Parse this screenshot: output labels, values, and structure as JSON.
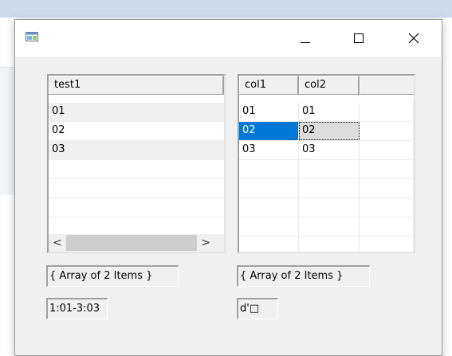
{
  "window": {
    "title": ""
  },
  "left_list": {
    "header": "test1",
    "rows": [
      "01",
      "02",
      "03"
    ],
    "selected_index": 1,
    "scroll_left": "<",
    "scroll_right": ">"
  },
  "right_grid": {
    "headers": [
      "col1",
      "col2",
      ""
    ],
    "rows": [
      [
        "01",
        "01"
      ],
      [
        "02",
        "02"
      ],
      [
        "03",
        "03"
      ]
    ],
    "selected_row": 1
  },
  "labels": {
    "left_array": "{ Array of 2 Items }",
    "left_range": "1:01-3:03",
    "right_array": "{ Array of 2 Items }",
    "right_value": "d'□"
  },
  "colors": {
    "selection": "#0078d7",
    "window_bg": "#f0f0f0"
  }
}
